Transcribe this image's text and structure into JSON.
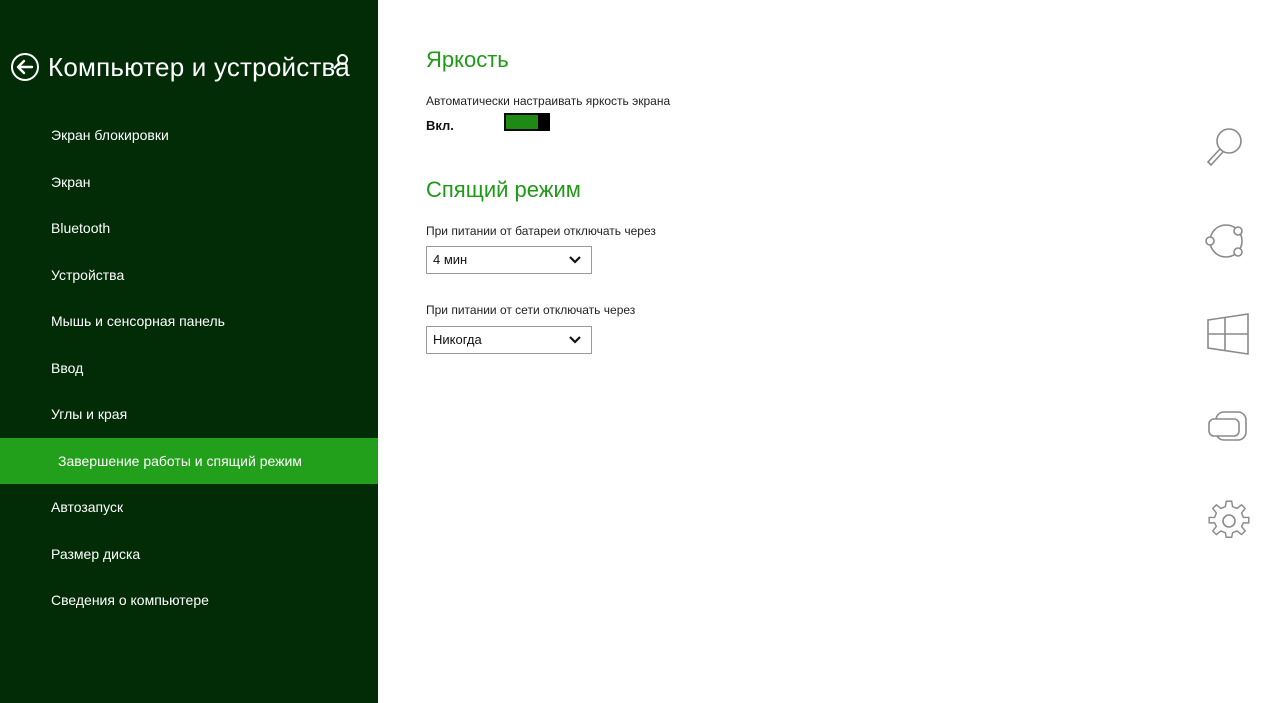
{
  "sidebar": {
    "title": "Компьютер и устройства",
    "items": [
      {
        "label": "Экран блокировки"
      },
      {
        "label": "Экран"
      },
      {
        "label": "Bluetooth"
      },
      {
        "label": "Устройства"
      },
      {
        "label": "Мышь и сенсорная панель"
      },
      {
        "label": "Ввод"
      },
      {
        "label": "Углы и края"
      },
      {
        "label": "Завершение работы и спящий режим",
        "active": true
      },
      {
        "label": "Автозапуск"
      },
      {
        "label": "Размер диска"
      },
      {
        "label": "Сведения о компьютере"
      }
    ]
  },
  "brightness": {
    "title": "Яркость",
    "auto_label": "Автоматически настраивать яркость экрана",
    "toggle_state": "Вкл.",
    "toggle_on": true
  },
  "sleep": {
    "title": "Спящий режим",
    "battery_label": "При питании от батареи отключать через",
    "battery_value": "4 мин",
    "ac_label": "При питании от сети отключать через",
    "ac_value": "Никогда"
  },
  "charms": [
    "search-icon",
    "share-icon",
    "start-icon",
    "devices-icon",
    "settings-icon"
  ],
  "colors": {
    "sidebar_bg": "#012c06",
    "accent": "#22a01b",
    "title": "#1e9a18"
  }
}
